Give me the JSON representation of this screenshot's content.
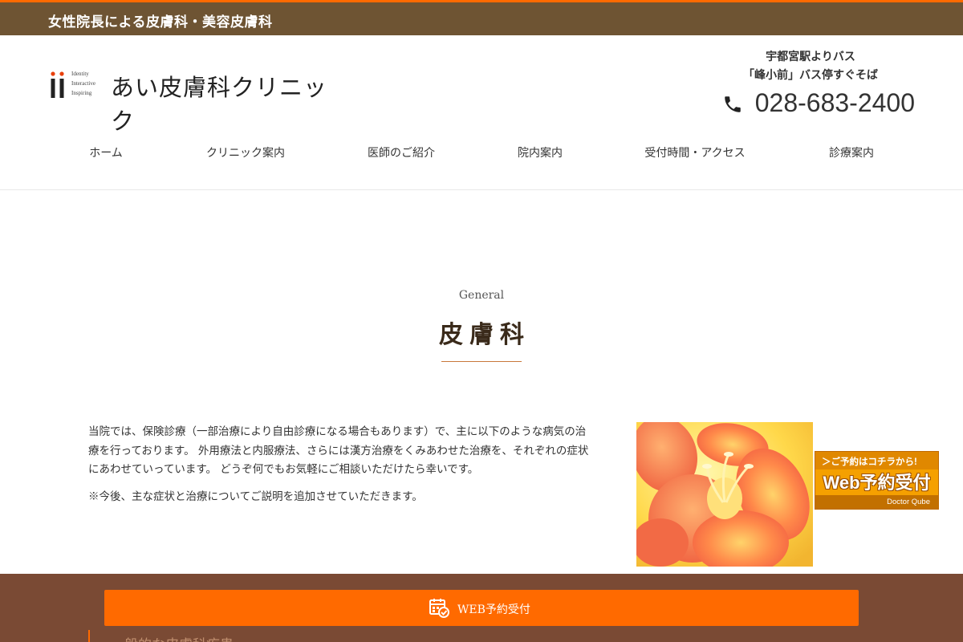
{
  "topbar": {
    "tagline": "女性院長による皮膚科・美容皮膚科"
  },
  "logo": {
    "name": "あい皮膚科クリニック",
    "taglines": [
      "Identity",
      "Interactive",
      "Inspiring"
    ]
  },
  "access": {
    "lines": [
      "宇都宮駅よりバス",
      "「峰小前」バス停すぐそば"
    ],
    "phone": "028-683-2400"
  },
  "nav": {
    "items": [
      {
        "label": "ホーム"
      },
      {
        "label": "クリニック案内"
      },
      {
        "label": "医師のご紹介"
      },
      {
        "label": "院内案内"
      },
      {
        "label": "受付時間・アクセス"
      },
      {
        "label": "診療案内"
      }
    ]
  },
  "section": {
    "eyebrow": "General",
    "title": "皮膚科",
    "body": "当院では、保険診療（一部治療により自由診療になる場合もあります）で、主に以下のような病気の治療を行っております。 外用療法と内服療法、さらには漢方治療をくみあわせた治療を、それぞれの症状にあわせていっています。 どうぞ何でもお気軽にご相談いただけたら幸いです。",
    "note": "※今後、主な症状と治療についてご説明を追加させていただきます。"
  },
  "web_badge": {
    "top": "＞ご予約はコチラから!",
    "main": "Web予約受付",
    "bottom": "Doctor Qube"
  },
  "footer_bar": {
    "reserve_label": "WEB予約受付",
    "peek_heading": "一般的な皮膚科疾患"
  },
  "colors": {
    "accent": "#ff6a00",
    "topbar": "#6e5433",
    "bottom_bar": "#7a4a34",
    "badge": "#f5a000"
  },
  "icons": {
    "phone": "phone-icon",
    "calendar": "calendar-check-icon"
  }
}
